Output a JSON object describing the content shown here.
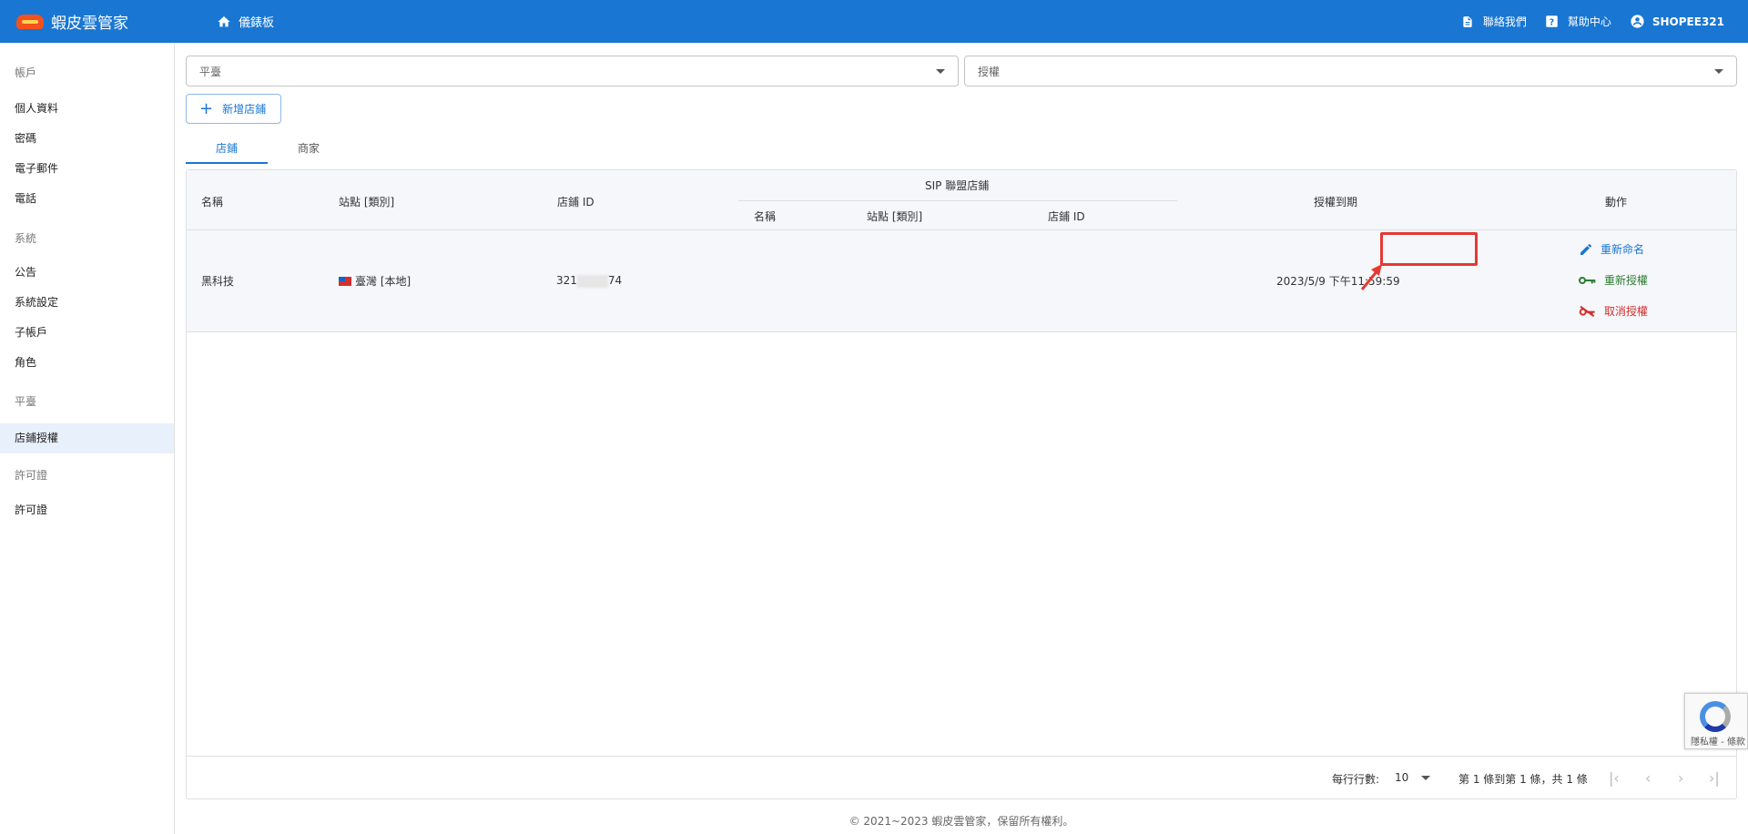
{
  "header": {
    "brand": "蝦皮雲管家",
    "dashboard": "儀錶板",
    "contact": "聯絡我們",
    "help": "幫助中心",
    "user": "SHOPEE321"
  },
  "sidebar": {
    "sections": [
      {
        "title": "帳戶",
        "items": [
          "個人資料",
          "密碼",
          "電子郵件",
          "電話"
        ]
      },
      {
        "title": "系統",
        "items": [
          "公告",
          "系統設定",
          "子帳戶",
          "角色"
        ]
      },
      {
        "title": "平臺",
        "items": [
          "店鋪授權"
        ]
      },
      {
        "title": "許可證",
        "items": [
          "許可證"
        ]
      }
    ],
    "active_item": "店鋪授權"
  },
  "filters": {
    "platform_placeholder": "平臺",
    "auth_placeholder": "授權"
  },
  "add_button": "新增店鋪",
  "tabs": [
    "店鋪",
    "商家"
  ],
  "active_tab": "店鋪",
  "table": {
    "headers": {
      "name": "名稱",
      "site": "站點 [類別]",
      "shop_id": "店鋪 ID",
      "sip": "SIP 聯盟店鋪",
      "sip_name": "名稱",
      "sip_site": "站點 [類別]",
      "sip_shop_id": "店鋪 ID",
      "expiry": "授權到期",
      "actions": "動作"
    },
    "rows": [
      {
        "name": "黑科技",
        "site": "臺灣 [本地]",
        "shop_id_prefix": "321",
        "shop_id_suffix": "74",
        "expiry": "2023/5/9 下午11:59:59",
        "actions": {
          "rename": "重新命名",
          "reauth": "重新授權",
          "cancel": "取消授權"
        }
      }
    ]
  },
  "pagination": {
    "rows_per_page_label": "每行行數:",
    "rows_per_page": "10",
    "range": "第 1 條到第 1 條，共 1 條"
  },
  "footer": {
    "copyright": "© 2021~2023 蝦皮雲管家，保留所有權利。"
  },
  "recaptcha": {
    "text": "隱私權 - 條款"
  },
  "colors": {
    "primary": "#1976d2",
    "rename": "#1976d2",
    "reauth": "#2e7d32",
    "cancel": "#d32f2f",
    "highlight": "#e53935"
  }
}
